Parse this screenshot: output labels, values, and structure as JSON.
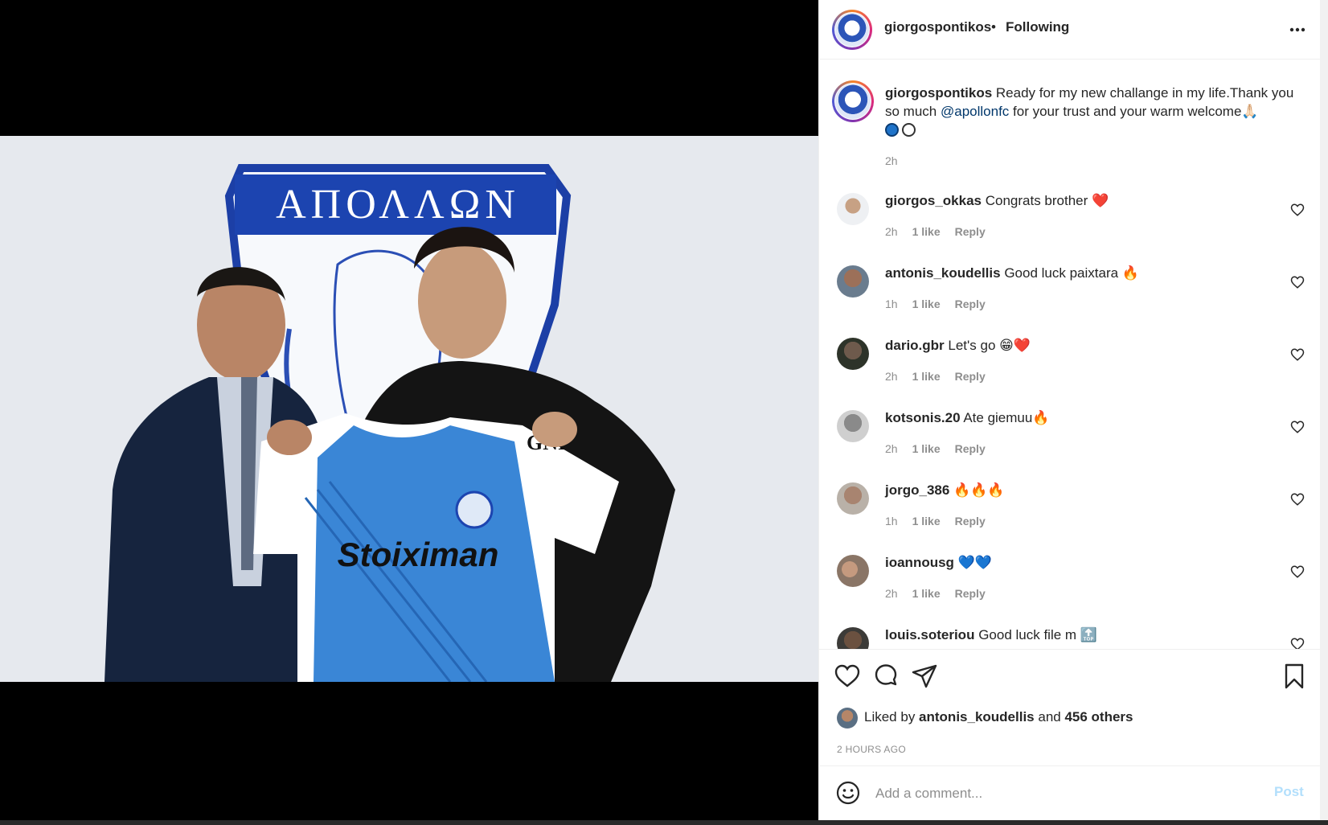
{
  "post": {
    "username": "giorgospontikos",
    "dot": "•",
    "follow_status": "Following",
    "media": {
      "description_icon": "photo",
      "crest_text": "ΑΠΟΛΛΩΝ",
      "shirt_sponsor": "Stoiximan",
      "sleeve_sponsor": "GNI"
    },
    "caption": {
      "username": "giorgospontikos",
      "text_before": " Ready for my new challange in my life.Thank you so much ",
      "mention": "@apollonfc",
      "text_after": " for your trust and your warm welcome🙏🏻",
      "time": "2h"
    },
    "comments": [
      {
        "username": "giorgos_okkas",
        "text": " Congrats brother ❤️",
        "time": "2h",
        "likes": "1 like",
        "reply": "Reply"
      },
      {
        "username": "antonis_koudellis",
        "text": " Good luck paixtara 🔥",
        "time": "1h",
        "likes": "1 like",
        "reply": "Reply"
      },
      {
        "username": "dario.gbr",
        "text": " Let's go 😁❤️",
        "time": "2h",
        "likes": "1 like",
        "reply": "Reply"
      },
      {
        "username": "kotsonis.20",
        "text": " Ate giemuu🔥",
        "time": "2h",
        "likes": "1 like",
        "reply": "Reply"
      },
      {
        "username": "jorgo_386",
        "text": " 🔥🔥🔥",
        "time": "1h",
        "likes": "1 like",
        "reply": "Reply"
      },
      {
        "username": "ioannousg",
        "text": " 💙💙",
        "time": "2h",
        "likes": "1 like",
        "reply": "Reply"
      },
      {
        "username": "louis.soteriou",
        "text": " Good luck file m 🔝",
        "time": "",
        "likes": "",
        "reply": ""
      }
    ],
    "liked_by": {
      "prefix": "Liked by ",
      "user": "antonis_koudellis",
      "middle": " and ",
      "others": "456 others"
    },
    "timestamp": "2 HOURS AGO",
    "add_comment": {
      "placeholder": "Add a comment...",
      "post_label": "Post"
    },
    "colors": {
      "accent_link": "#00376b",
      "post_button_disabled": "#b2dffc",
      "muted": "#8e8e8e",
      "text": "#262626"
    }
  }
}
